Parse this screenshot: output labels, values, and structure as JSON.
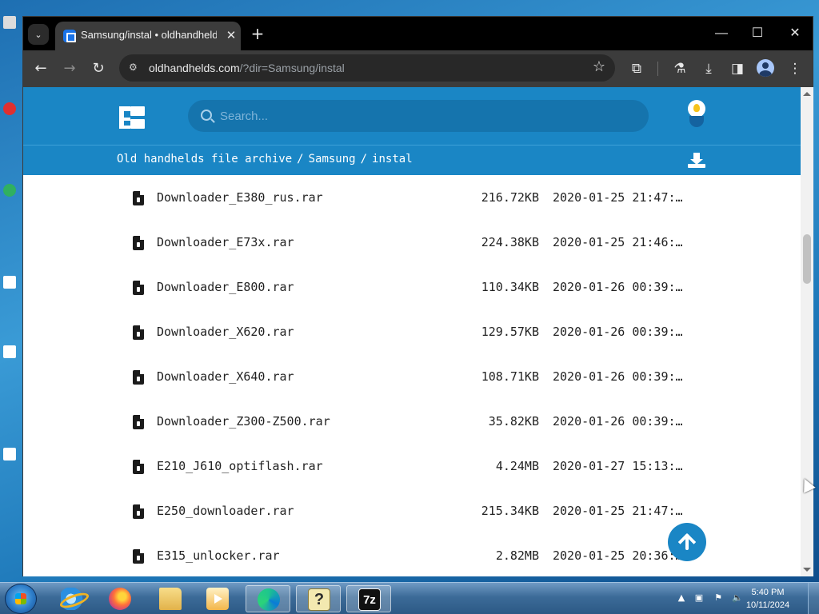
{
  "browser": {
    "tab_title": "Samsung/instal • oldhandhelds",
    "tab_close_glyph": "✕",
    "new_tab_glyph": "+",
    "tab_list_glyph": "⌄",
    "url_host": "oldhandhelds.com",
    "url_path": "/?dir=Samsung/instal",
    "window_controls": {
      "minimize": "—",
      "maximize": "☐",
      "close": "✕"
    },
    "toolbar_icons": [
      "back-arrow-icon",
      "forward-arrow-icon",
      "reload-icon",
      "site-info-icon",
      "bookmark-star-icon",
      "extensions-icon",
      "labs-flask-icon",
      "download-icon",
      "side-panel-icon",
      "profile-avatar-icon",
      "menu-kebab-icon"
    ]
  },
  "site": {
    "search_placeholder": "Search...",
    "breadcrumb": [
      "Old handhelds file archive",
      "Samsung",
      "instal"
    ],
    "breadcrumb_separator": "/",
    "accent_color": "#1a86c5"
  },
  "files": [
    {
      "name": "Downloader_E380_rus.rar",
      "size": "216.72KB",
      "date": "2020-01-25 21:47:…"
    },
    {
      "name": "Downloader_E73x.rar",
      "size": "224.38KB",
      "date": "2020-01-25 21:46:…"
    },
    {
      "name": "Downloader_E800.rar",
      "size": "110.34KB",
      "date": "2020-01-26 00:39:…"
    },
    {
      "name": "Downloader_X620.rar",
      "size": "129.57KB",
      "date": "2020-01-26 00:39:…"
    },
    {
      "name": "Downloader_X640.rar",
      "size": "108.71KB",
      "date": "2020-01-26 00:39:…"
    },
    {
      "name": "Downloader_Z300-Z500.rar",
      "size": "35.82KB",
      "date": "2020-01-26 00:39:…"
    },
    {
      "name": "E210_J610_optiflash.rar",
      "size": "4.24MB",
      "date": "2020-01-27 15:13:…"
    },
    {
      "name": "E250_downloader.rar",
      "size": "215.34KB",
      "date": "2020-01-25 21:47:…"
    },
    {
      "name": "E315_unlocker.rar",
      "size": "2.82MB",
      "date": "2020-01-25 20:36:…"
    }
  ],
  "taskbar": {
    "apps": [
      "internet-explorer-icon",
      "firefox-icon",
      "file-explorer-icon",
      "media-player-icon",
      "edge-icon",
      "help-icon",
      "7zip-icon"
    ],
    "help_glyph": "?",
    "zip_glyph": "7z",
    "time": "5:40 PM",
    "date": "10/11/2024"
  }
}
